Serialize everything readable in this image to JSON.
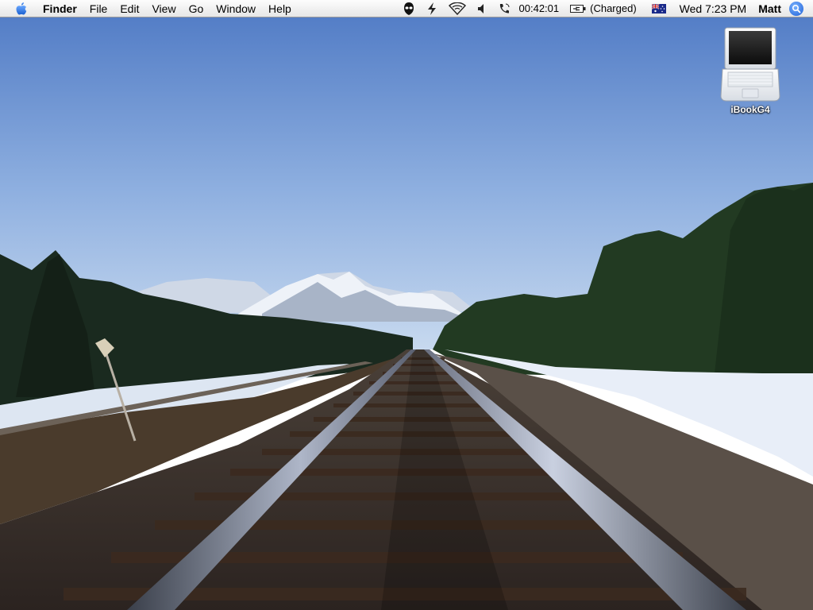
{
  "menubar": {
    "apple_icon": "apple-logo-icon",
    "app_name": "Finder",
    "menus": [
      "File",
      "Edit",
      "View",
      "Go",
      "Window",
      "Help"
    ],
    "extras": {
      "timer": "00:42:01",
      "battery": "(Charged)",
      "clock": "Wed 7:23 PM",
      "user": "Matt"
    },
    "icons": [
      "alien-menu-icon",
      "script-menu-icon",
      "airport-icon",
      "volume-icon",
      "phone-icon",
      "battery-plug-icon",
      "australia-flag-icon",
      "spotlight-icon"
    ]
  },
  "desktop": {
    "icons": [
      {
        "label": "iBookG4",
        "icon": "laptop-icon"
      }
    ]
  }
}
